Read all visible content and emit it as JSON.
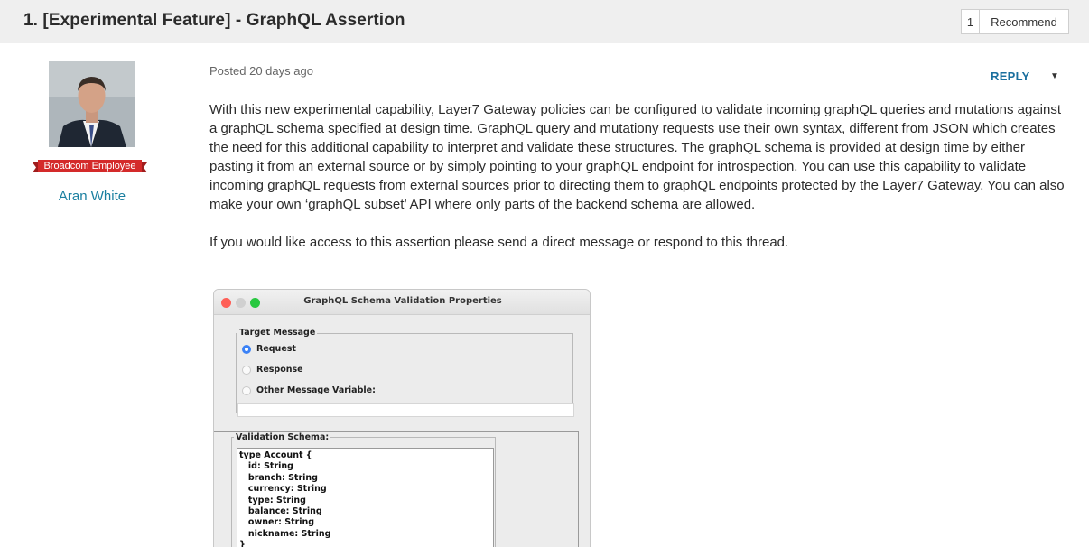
{
  "thread": {
    "title": "1. [Experimental Feature] - GraphQL Assertion",
    "recommend_count": "1",
    "recommend_label": "Recommend"
  },
  "author": {
    "name": "Aran White",
    "badge": "Broadcom Employee"
  },
  "post": {
    "posted": "Posted 20 days ago",
    "reply_label": "REPLY",
    "paragraphs": [
      "With this new experimental capability, Layer7 Gateway policies can be configured to validate incoming graphQL queries and mutations against a graphQL schema specified at design time. GraphQL query and mutationy requests use their own syntax, different from JSON which creates the need for this additional capability to interpret and validate these structures. The graphQL schema is provided at design time by either pasting it from an external source or by simply pointing to your graphQL endpoint for introspection. You can use this capability to validate incoming graphQL requests from external sources prior to directing them to graphQL endpoints protected by the Layer7 Gateway. You can also make your own ‘graphQL subset’ API where only parts of the backend schema are allowed.",
      "If you would like access to this assertion please send a direct message or respond to this thread."
    ]
  },
  "dialog": {
    "title": "GraphQL Schema Validation Properties",
    "target_legend": "Target Message",
    "options": [
      "Request",
      "Response",
      "Other Message Variable:"
    ],
    "selected": "Request",
    "schema_legend": "Validation Schema:",
    "schema_text": "type Account {\n   id: String\n   branch: String\n   currency: String\n   type: String\n   balance: String\n   owner: String\n   nickname: String\n}"
  },
  "colors": {
    "header_bg": "#efefef",
    "link": "#1a7fa0",
    "reply": "#1a6f9e",
    "badge": "#d42a2a"
  }
}
